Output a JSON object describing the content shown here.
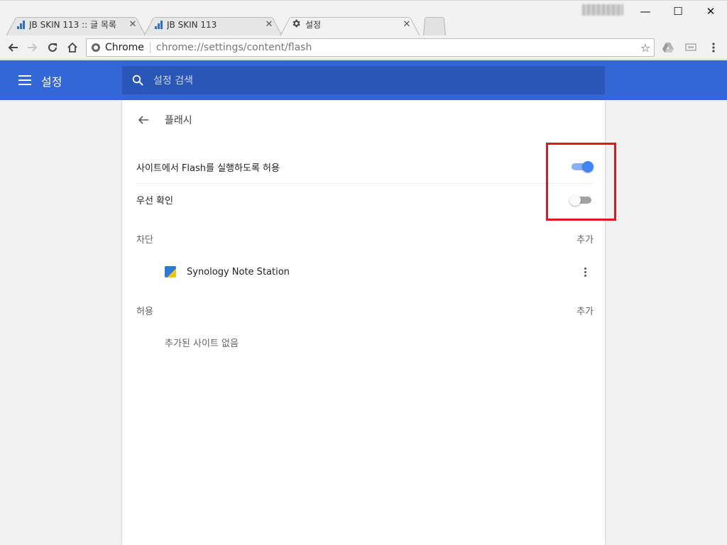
{
  "browser": {
    "tabs": [
      {
        "title": "JB SKIN 113 :: 글 목록",
        "close": "✕"
      },
      {
        "title": "JB SKIN 113",
        "close": "✕"
      },
      {
        "title": "설정",
        "close": "✕"
      }
    ],
    "window_controls": {
      "minimize": "—",
      "maximize": "☐",
      "close": "✕"
    },
    "omnibox": {
      "chip": "Chrome",
      "url": "chrome://settings/content/flash"
    }
  },
  "header": {
    "title": "설정",
    "search_placeholder": "설정 검색",
    "accent_color": "#3367d6"
  },
  "flash_page": {
    "title": "플래시",
    "allow_flash": {
      "label": "사이트에서 Flash를 실행하도록 허용",
      "enabled": true
    },
    "ask_first": {
      "label": "우선 확인",
      "enabled": false
    },
    "blocked": {
      "heading": "차단",
      "add_label": "추가",
      "sites": [
        {
          "name": "Synology Note Station"
        }
      ]
    },
    "allowed": {
      "heading": "허용",
      "add_label": "추가",
      "empty_text": "추가된 사이트 없음"
    }
  },
  "annotation": {
    "color": "#e4161b"
  }
}
